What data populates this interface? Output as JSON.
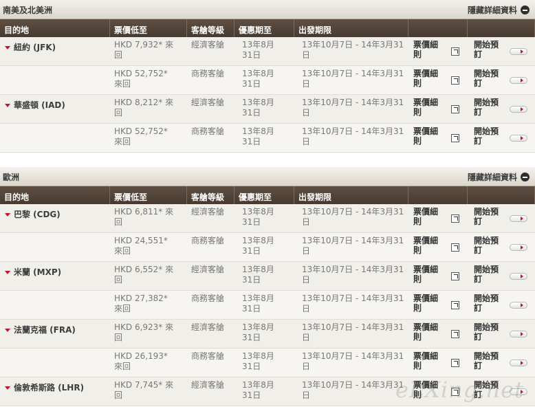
{
  "headers": {
    "destination": "目的地",
    "fare_from": "票價低至",
    "cabin": "客艙等級",
    "offer_until": "優惠期至",
    "travel_period": "出發期限"
  },
  "links": {
    "fare_details": "票價細則",
    "book_now": "開始預訂"
  },
  "sections": [
    {
      "title": "南美及北美洲",
      "toggle_label": "隱藏詳細資料",
      "rows": [
        {
          "dest": "紐約 (JFK)",
          "fare": "HKD 7,932* 來回",
          "cabin": "經濟客艙",
          "offer": "13年8月31日",
          "travel": "13年10月7日 - 14年3月31日"
        },
        {
          "dest": "",
          "fare": "HKD 52,752* 來回",
          "cabin": "商務客艙",
          "offer": "13年8月31日",
          "travel": "13年10月7日 - 14年3月31日"
        },
        {
          "dest": "華盛頓 (IAD)",
          "fare": "HKD 8,212* 來回",
          "cabin": "經濟客艙",
          "offer": "13年8月31日",
          "travel": "13年10月7日 - 14年3月31日"
        },
        {
          "dest": "",
          "fare": "HKD 52,752* 來回",
          "cabin": "商務客艙",
          "offer": "13年8月31日",
          "travel": "13年10月7日 - 14年3月31日"
        }
      ]
    },
    {
      "title": "歐洲",
      "toggle_label": "隱藏詳細資料",
      "rows": [
        {
          "dest": "巴黎 (CDG)",
          "fare": "HKD 6,811* 來回",
          "cabin": "經濟客艙",
          "offer": "13年8月31日",
          "travel": "13年10月7日 - 14年3月31日"
        },
        {
          "dest": "",
          "fare": "HKD 24,551* 來回",
          "cabin": "商務客艙",
          "offer": "13年8月31日",
          "travel": "13年10月7日 - 14年3月31日"
        },
        {
          "dest": "米蘭 (MXP)",
          "fare": "HKD 6,552* 來回",
          "cabin": "經濟客艙",
          "offer": "13年8月31日",
          "travel": "13年10月7日 - 14年3月31日"
        },
        {
          "dest": "",
          "fare": "HKD 27,382* 來回",
          "cabin": "商務客艙",
          "offer": "13年8月31日",
          "travel": "13年10月7日 - 14年3月31日"
        },
        {
          "dest": "法蘭克福 (FRA)",
          "fare": "HKD 6,923* 來回",
          "cabin": "經濟客艙",
          "offer": "13年8月31日",
          "travel": "13年10月7日 - 14年3月31日"
        },
        {
          "dest": "",
          "fare": "HKD 26,193* 來回",
          "cabin": "商務客艙",
          "offer": "13年8月31日",
          "travel": "13年10月7日 - 14年3月31日"
        },
        {
          "dest": "倫敦希斯路 (LHR)",
          "fare": "HKD 7,745* 來回",
          "cabin": "經濟客艙",
          "offer": "13年8月31日",
          "travel": "13年10月7日 - 14年3月31日"
        }
      ]
    }
  ],
  "watermark": "eLXing.net",
  "icons": {
    "row_marker": "red-triangle-down-icon",
    "fare_details": "external-link-icon",
    "book_now": "red-arrow-button",
    "toggle": "minus-circle-icon"
  },
  "colors": {
    "header_bg": "#4f4137",
    "accent_red": "#c8102e",
    "row_odd": "#f1efe9",
    "row_even": "#f6f5f1"
  }
}
